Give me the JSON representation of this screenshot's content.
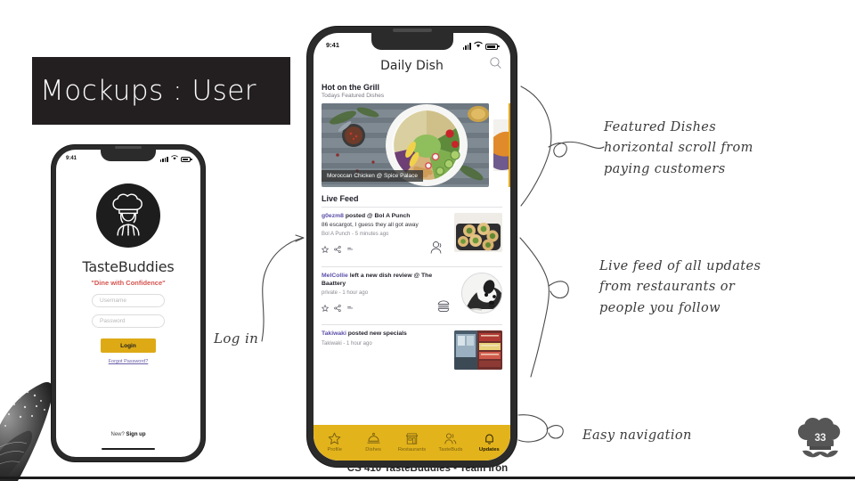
{
  "slide": {
    "title": "Mockups : User",
    "footer_caption": "CS 410 TasteBuddies - Team Iron",
    "page_number": "33"
  },
  "colors": {
    "banner_bg": "#231f20",
    "brand_yellow": "#e3b31c",
    "login_button": "#ddaa16",
    "tagline_red": "#d4544f",
    "username_purple": "#5b4fa8",
    "phone_body": "#2b2b2b"
  },
  "login_phone": {
    "status_bar": {
      "time": "9:41",
      "signal_icon": "signal-bars-icon",
      "wifi_icon": "wifi-icon",
      "battery_icon": "battery-icon"
    },
    "logo_icon": "chef-logo-icon",
    "brand_name": "TasteBuddies",
    "tagline": "\"Dine with Confidence\"",
    "username_placeholder": "Username",
    "password_placeholder": "Password",
    "username_value": "",
    "password_value": "",
    "login_button": "Login",
    "forgot_link": "Forgot Password?",
    "signup_prefix": "New? ",
    "signup_link": "Sign up"
  },
  "feed_phone": {
    "status_bar": {
      "time": "9:41",
      "signal_icon": "signal-bars-icon",
      "wifi_icon": "wifi-icon",
      "battery_icon": "battery-icon"
    },
    "app_title": "Daily Dish",
    "search_icon": "search-icon",
    "featured": {
      "section_title": "Hot on the Grill",
      "section_subtitle": "Todays Featured Dishes",
      "cards": [
        {
          "caption": "Moroccan Chicken @ Spice Palace",
          "image": "salad-bowl-photo"
        },
        {
          "caption": "",
          "image": "sandwich-photo-partial"
        }
      ]
    },
    "live_feed": {
      "section_title": "Live Feed",
      "posts": [
        {
          "user": "g0ezm8",
          "title_rest": " posted @ Bol A Punch",
          "body": "86 escargot, I guess they all got away",
          "meta": "Bol A Punch - 5 minutes ago",
          "actions": [
            "star-icon",
            "share-icon",
            "more-icon"
          ],
          "badge_icon": "people-icon",
          "thumb": "escargot-photo"
        },
        {
          "user": "MelCollie",
          "title_rest": " left a new dish review @ The Baattery",
          "body": "",
          "meta": "private - 1 hour ago",
          "actions": [
            "star-icon",
            "share-icon",
            "more-icon"
          ],
          "badge_icon": "burger-icon",
          "thumb": "dog-photo"
        },
        {
          "user": "Takiwaki",
          "title_rest": " posted new specials",
          "body": "",
          "meta": "Takiwaki - 1 hour ago",
          "actions": [],
          "badge_icon": "storefront-icon",
          "thumb": "restaurant-photo"
        }
      ]
    },
    "bottom_nav": [
      {
        "label": "Profile",
        "icon": "star-icon",
        "active": false
      },
      {
        "label": "Dishes",
        "icon": "cloche-icon",
        "active": false
      },
      {
        "label": "Restaurants",
        "icon": "storefront-icon",
        "active": false
      },
      {
        "label": "TasteBuds",
        "icon": "people-icon",
        "active": false
      },
      {
        "label": "Updates",
        "icon": "bell-icon",
        "active": true
      }
    ]
  },
  "annotations": {
    "featured": "Featured Dishes\nhorizontal scroll from\npaying customers",
    "live_feed": "Live feed of all updates\nfrom restaurants or\npeople you follow",
    "navigation": "Easy navigation",
    "login": "Log in"
  }
}
